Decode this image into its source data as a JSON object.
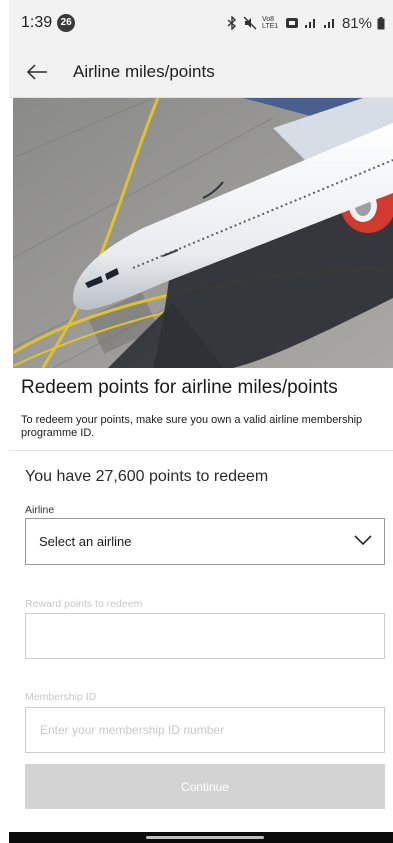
{
  "status_bar": {
    "time": "1:39",
    "notification_count": "26",
    "network_labels": "Vo8 LTE1",
    "battery": "81%"
  },
  "app_bar": {
    "title": "Airline miles/points",
    "back_icon": "arrow-left-icon"
  },
  "hero": {
    "image": "aerial-airplane-photo"
  },
  "page": {
    "heading": "Redeem points for airline miles/points",
    "note": "To redeem your points, make sure you own a valid airline membership programme ID.",
    "points_summary": "You have 27,600 points to redeem"
  },
  "form": {
    "airline_label": "Airline",
    "airline_value": "Select an airline",
    "reward_label": "Reward points to redeem",
    "reward_value": "",
    "membership_label": "Membership ID",
    "membership_placeholder": "Enter your membership ID number",
    "continue_label": "Continue"
  }
}
